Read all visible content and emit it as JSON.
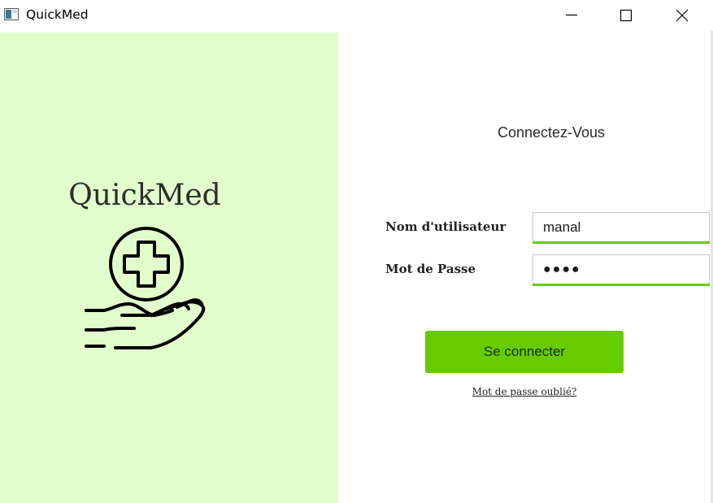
{
  "window": {
    "title": "QuickMed",
    "icon": "app-window-icon",
    "controls": [
      "minimize-icon",
      "maximize-icon",
      "close-icon"
    ]
  },
  "brand": {
    "name": "QuickMed",
    "logo_icon": "hand-holding-medical-cross-icon",
    "panel_color": "#e2fccc"
  },
  "login": {
    "title": "Connectez-Vous",
    "username_label": "Nom d'utilisateur",
    "username_value": "manal",
    "password_label": "Mot de Passe",
    "password_value": "●●●●",
    "submit_label": "Se connecter",
    "forgot_label": "Mot de passe oublié?",
    "accent_color": "#66cc00"
  }
}
